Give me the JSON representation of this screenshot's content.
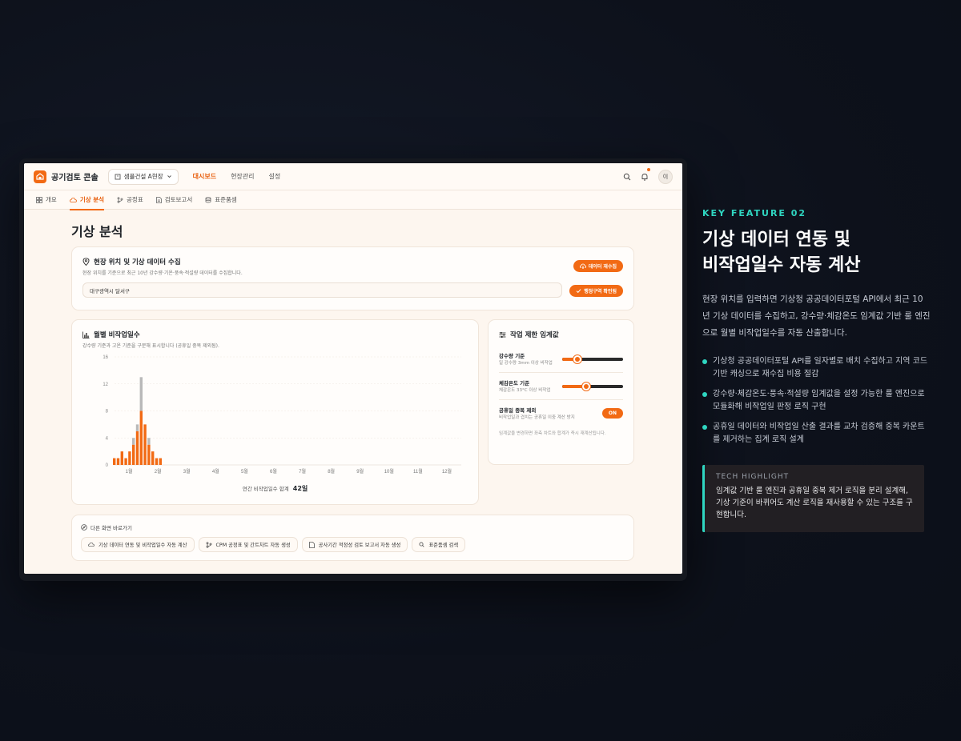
{
  "app": {
    "title": "공기검토 콘솔",
    "site": "샘플건설 A현장",
    "nav": [
      "대시보드",
      "현장관리",
      "설정"
    ],
    "avatar": "이"
  },
  "subnav": [
    "개요",
    "기상 분석",
    "공정표",
    "검토보고서",
    "표준품셈"
  ],
  "page_title": "기상 분석",
  "collect_card": {
    "title": "현장 위치 및 기상 데이터 수집",
    "subtitle": "현장 위치를 기준으로 최근 10년 강수량·기온·풍속·적설량 데이터를 수집합니다.",
    "refresh_button": "데이터 재수집",
    "location_value": "대구광역시 달서구",
    "confirm_button": "행정구역 확인됨"
  },
  "chart_card": {
    "title": "월별 비작업일수",
    "subtitle": "강수량 기준과 고온 기준을 구분해 표시합니다 (공휴일 중복 제외됨).",
    "total_label": "연간 비작업일수 합계",
    "total_value": "42일"
  },
  "chart_data": {
    "type": "bar",
    "stacked": true,
    "y_ticks": [
      "0",
      "4",
      "8",
      "12",
      "16"
    ],
    "ylim": [
      0,
      16
    ],
    "month_labels": [
      "1월",
      "2월",
      "3월",
      "4월",
      "5월",
      "6월",
      "7월",
      "8월",
      "9월",
      "10월",
      "11월",
      "12월"
    ],
    "series": [
      {
        "color": "#f26a14",
        "values": [
          1,
          1,
          2,
          1,
          2,
          3,
          5,
          8,
          6,
          3,
          2,
          1,
          1
        ]
      },
      {
        "color": "#b9b9b9",
        "values": [
          0,
          0,
          0,
          0,
          0,
          1,
          1,
          5,
          0,
          1,
          0,
          0,
          0
        ]
      }
    ]
  },
  "threshold_card": {
    "title": "작업 제한 임계값",
    "rows": [
      {
        "name": "강수량 기준",
        "desc": "일 강수량 3mm 이상 비작업",
        "level": 0.25
      },
      {
        "name": "체감온도 기준",
        "desc": "체감온도 33°C 이상 비작업",
        "level": 0.4
      },
      {
        "name": "공휴일 중복 제외",
        "desc": "비작업일과 겹치는 공휴일 이중 계산 방지",
        "toggle": "ON"
      }
    ],
    "note": "임계값을 변경하면 좌측 차트와 합계가 즉시 재계산됩니다."
  },
  "shortcuts": {
    "title": "다른 화면 바로가기",
    "items": [
      "기상 데이터 연동 및 비작업일수 자동 계산",
      "CPM 공정표 및 간트차트 자동 생성",
      "공사기간 적정성 검토 보고서 자동 생성",
      "표준품셈 검색"
    ]
  },
  "feature": {
    "kicker": "KEY FEATURE 02",
    "title_line1": "기상 데이터 연동 및",
    "title_line2": "비작업일수 자동 계산",
    "description": "현장 위치를 입력하면 기상청 공공데이터포털 API에서 최근 10년 기상 데이터를 수집하고, 강수량·체감온도 임계값 기반 룰 엔진으로 월별 비작업일수를 자동 산출합니다.",
    "bullets": [
      "기상청 공공데이터포털 API를 일자별로 배치 수집하고 지역 코드 기반 캐싱으로 재수집 비용 절감",
      "강수량·체감온도·풍속·적설량 임계값을 설정 가능한 룰 엔진으로 모듈화해 비작업일 판정 로직 구현",
      "공휴일 데이터와 비작업일 산출 결과를 교차 검증해 중복 카운트를 제거하는 집계 로직 설계"
    ],
    "tech_label": "TECH HIGHLIGHT",
    "tech_text": "임계값 기반 룰 엔진과 공휴일 중복 제거 로직을 분리 설계해, 기상 기준이 바뀌어도 계산 로직을 재사용할 수 있는 구조를 구현합니다."
  },
  "colors": {
    "accent": "#f26a14",
    "teal": "#2fd6c1",
    "background": "#0d111b"
  }
}
